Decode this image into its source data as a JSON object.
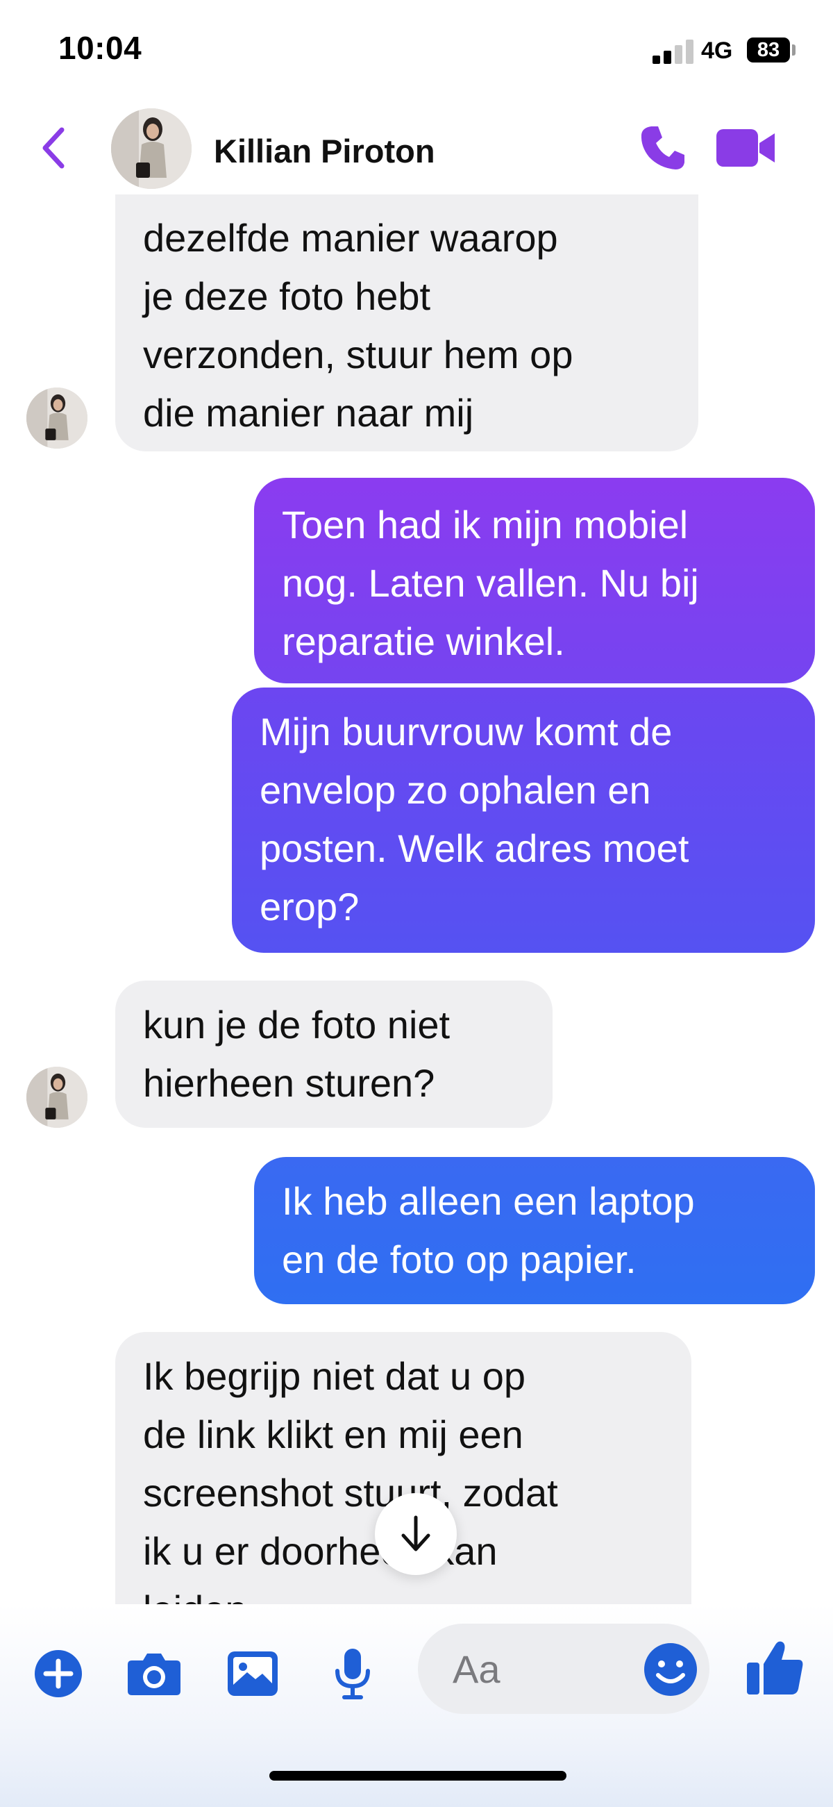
{
  "status_bar": {
    "time": "10:04",
    "network": "4G",
    "battery": "83"
  },
  "header": {
    "contact_name": "Killian Piroton",
    "icons": [
      "back-chevron-icon",
      "phone-icon",
      "video-camera-icon"
    ],
    "accent_color": "#8a3ce6"
  },
  "messages": [
    {
      "sender": "contact",
      "text": "dezelfde manier waarop\nje deze foto hebt\nverzonden, stuur hem op\ndie manier naar mij"
    },
    {
      "sender": "me",
      "text": "Toen had ik mijn mobiel\nnog. Laten vallen. Nu bij\nreparatie winkel."
    },
    {
      "sender": "me",
      "text": "Mijn buurvrouw komt de\nenvelop zo ophalen en\nposten. Welk adres moet\nerop?"
    },
    {
      "sender": "contact",
      "text": "kun je de foto niet\nhierheen sturen?"
    },
    {
      "sender": "me",
      "text": "Ik heb alleen een laptop\nen de foto op papier."
    },
    {
      "sender": "contact",
      "text": "Ik begrijp niet dat u op\nde link klikt en mij een\nscreenshot stuurt, zodat\nik u er doorheen kan\nleiden."
    }
  ],
  "composer": {
    "placeholder": "Aa",
    "tools": [
      "plus-icon",
      "camera-icon",
      "image-icon",
      "microphone-icon"
    ],
    "icon_color": "#1f5fd6"
  },
  "colors": {
    "incoming_bubble": "#efeff1",
    "outgoing_top": "#8b3cf0",
    "outgoing_bottom": "#2f6ff2"
  }
}
